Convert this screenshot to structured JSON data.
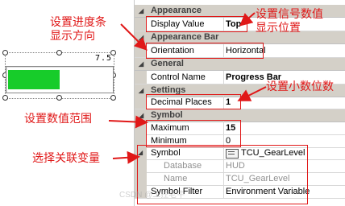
{
  "property_grid": {
    "categories": {
      "appearance": "Appearance",
      "appearance_bar": "Appearance Bar",
      "general": "General",
      "settings": "Settings",
      "symbol": "Symbol"
    },
    "rows": {
      "display_value": {
        "name": "Display Value",
        "value": "Top"
      },
      "orientation": {
        "name": "Orientation",
        "value": "Horizontal"
      },
      "control_name": {
        "name": "Control Name",
        "value": "Progress Bar"
      },
      "decimal_places": {
        "name": "Decimal Places",
        "value": "1"
      },
      "maximum": {
        "name": "Maximum",
        "value": "15"
      },
      "minimum": {
        "name": "Minimum",
        "value": "0"
      },
      "symbol": {
        "name": "Symbol",
        "value": "TCU_GearLevel"
      },
      "database": {
        "name": "Database",
        "value": "HUD"
      },
      "sym_name": {
        "name": "Name",
        "value": "TCU_GearLevel"
      },
      "symbol_filter": {
        "name": "Symbol Filter",
        "value": "Environment Variable"
      }
    }
  },
  "progress_bar": {
    "value_text": "7.5",
    "fill_fraction": 0.5,
    "fill_color": "#17cc2a"
  },
  "annotations": {
    "orientation_note": "设置进度条\n显示方向",
    "display_value_note": "设置信号数值\n显示位置",
    "decimal_note": "设置小数位数",
    "range_note": "设置数值范围",
    "symbol_note": "选择关联变量"
  },
  "watermark": "CSDN @工控老牛",
  "colors": {
    "accent": "#e01818",
    "category_bg": "#d4d0c8"
  }
}
